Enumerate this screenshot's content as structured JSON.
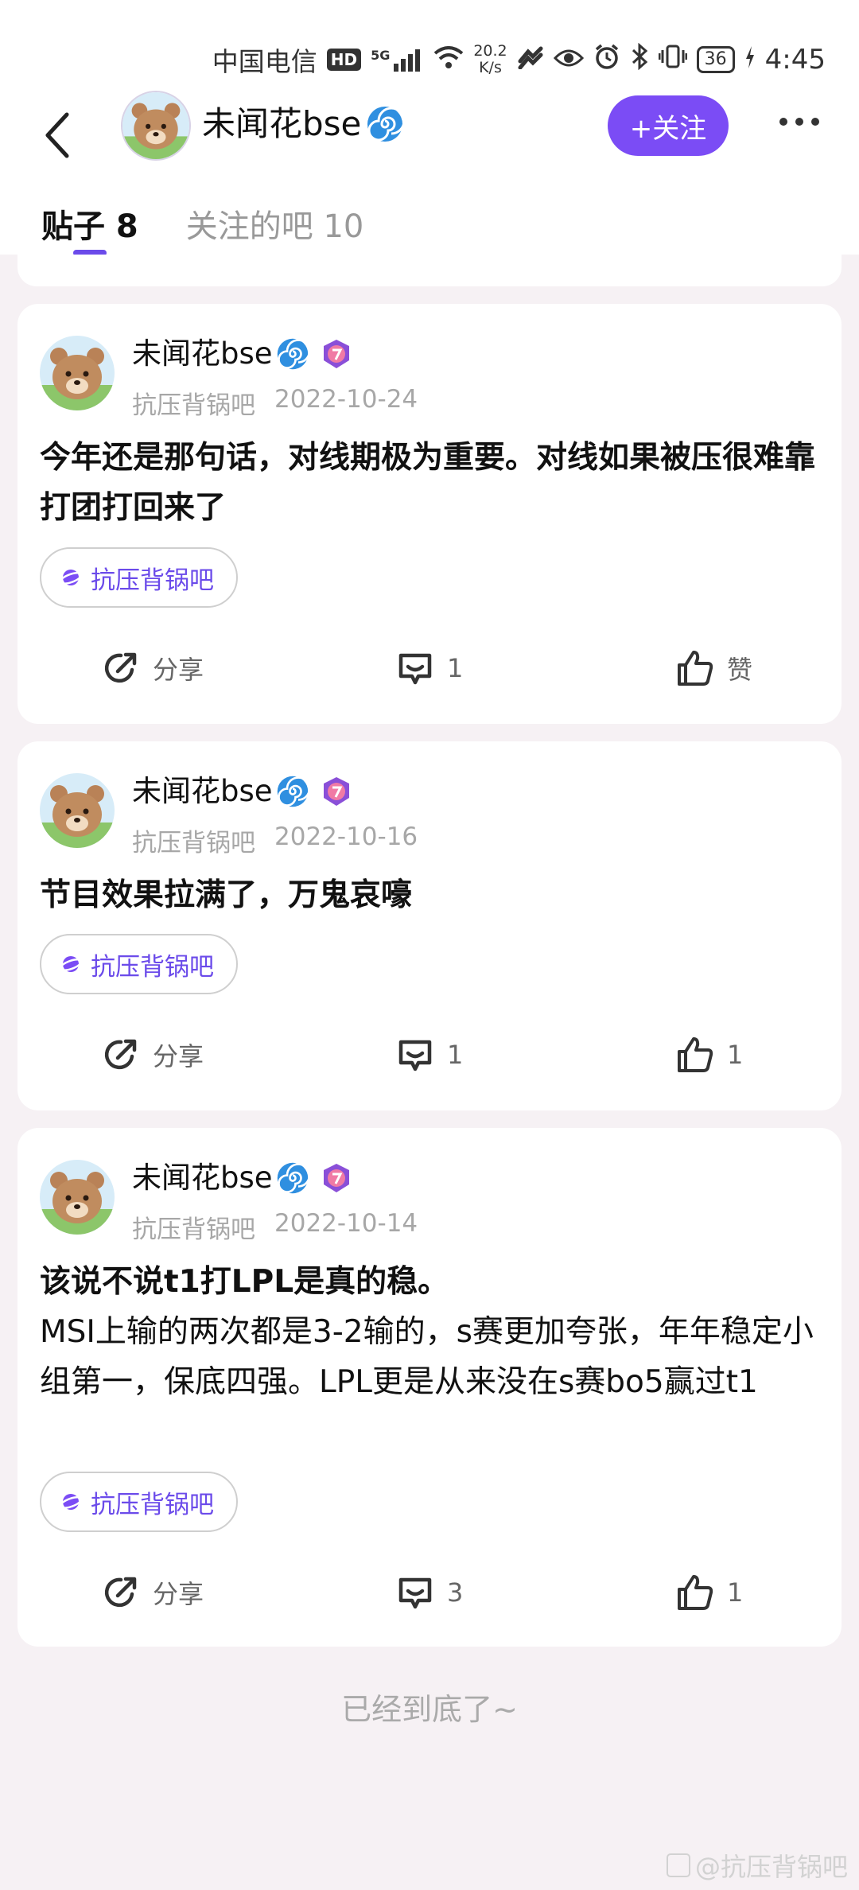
{
  "status_bar": {
    "carrier": "中国电信",
    "hd_badge": "HD",
    "network": "5G",
    "speed_value": "20.2",
    "speed_unit": "K/s",
    "battery": "36",
    "time": "4:45"
  },
  "header": {
    "username": "未闻花bse",
    "follow_label": "+关注",
    "tabs": [
      {
        "label": "贴子 8"
      },
      {
        "label": "关注的吧 10"
      }
    ]
  },
  "posts": [
    {
      "author": "未闻花bse",
      "forum": "抗压背锅吧",
      "date": "2022-10-24",
      "title": "今年还是那句话，对线期极为重要。对线如果被压很难靠打团打回来了",
      "content": "",
      "tag": "抗压背锅吧",
      "share_label": "分享",
      "comment_count": "1",
      "like_label": "赞"
    },
    {
      "author": "未闻花bse",
      "forum": "抗压背锅吧",
      "date": "2022-10-16",
      "title": "节目效果拉满了，万鬼哀嚎",
      "content": "",
      "tag": "抗压背锅吧",
      "share_label": "分享",
      "comment_count": "1",
      "like_label": "1"
    },
    {
      "author": "未闻花bse",
      "forum": "抗压背锅吧",
      "date": "2022-10-14",
      "title": "该说不说t1打LPL是真的稳。",
      "content": "MSI上输的两次都是3-2输的，s赛更加夸张，年年稳定小组第一，保底四强。LPL更是从来没在s赛bo5赢过t1",
      "tag": "抗压背锅吧",
      "share_label": "分享",
      "comment_count": "3",
      "like_label": "1"
    }
  ],
  "footer": {
    "end_text": "已经到底了~",
    "watermark": "@抗压背锅吧"
  },
  "colors": {
    "accent": "#7b4cf5",
    "background": "#f6f1f4"
  }
}
